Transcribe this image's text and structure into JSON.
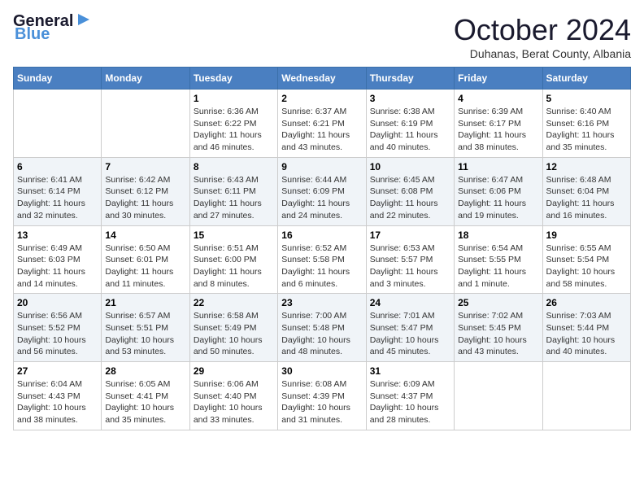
{
  "header": {
    "logo_line1": "General",
    "logo_line2": "Blue",
    "month_title": "October 2024",
    "location": "Duhanas, Berat County, Albania"
  },
  "days_of_week": [
    "Sunday",
    "Monday",
    "Tuesday",
    "Wednesday",
    "Thursday",
    "Friday",
    "Saturday"
  ],
  "weeks": [
    [
      {
        "day": "",
        "detail": ""
      },
      {
        "day": "",
        "detail": ""
      },
      {
        "day": "1",
        "detail": "Sunrise: 6:36 AM\nSunset: 6:22 PM\nDaylight: 11 hours and 46 minutes."
      },
      {
        "day": "2",
        "detail": "Sunrise: 6:37 AM\nSunset: 6:21 PM\nDaylight: 11 hours and 43 minutes."
      },
      {
        "day": "3",
        "detail": "Sunrise: 6:38 AM\nSunset: 6:19 PM\nDaylight: 11 hours and 40 minutes."
      },
      {
        "day": "4",
        "detail": "Sunrise: 6:39 AM\nSunset: 6:17 PM\nDaylight: 11 hours and 38 minutes."
      },
      {
        "day": "5",
        "detail": "Sunrise: 6:40 AM\nSunset: 6:16 PM\nDaylight: 11 hours and 35 minutes."
      }
    ],
    [
      {
        "day": "6",
        "detail": "Sunrise: 6:41 AM\nSunset: 6:14 PM\nDaylight: 11 hours and 32 minutes."
      },
      {
        "day": "7",
        "detail": "Sunrise: 6:42 AM\nSunset: 6:12 PM\nDaylight: 11 hours and 30 minutes."
      },
      {
        "day": "8",
        "detail": "Sunrise: 6:43 AM\nSunset: 6:11 PM\nDaylight: 11 hours and 27 minutes."
      },
      {
        "day": "9",
        "detail": "Sunrise: 6:44 AM\nSunset: 6:09 PM\nDaylight: 11 hours and 24 minutes."
      },
      {
        "day": "10",
        "detail": "Sunrise: 6:45 AM\nSunset: 6:08 PM\nDaylight: 11 hours and 22 minutes."
      },
      {
        "day": "11",
        "detail": "Sunrise: 6:47 AM\nSunset: 6:06 PM\nDaylight: 11 hours and 19 minutes."
      },
      {
        "day": "12",
        "detail": "Sunrise: 6:48 AM\nSunset: 6:04 PM\nDaylight: 11 hours and 16 minutes."
      }
    ],
    [
      {
        "day": "13",
        "detail": "Sunrise: 6:49 AM\nSunset: 6:03 PM\nDaylight: 11 hours and 14 minutes."
      },
      {
        "day": "14",
        "detail": "Sunrise: 6:50 AM\nSunset: 6:01 PM\nDaylight: 11 hours and 11 minutes."
      },
      {
        "day": "15",
        "detail": "Sunrise: 6:51 AM\nSunset: 6:00 PM\nDaylight: 11 hours and 8 minutes."
      },
      {
        "day": "16",
        "detail": "Sunrise: 6:52 AM\nSunset: 5:58 PM\nDaylight: 11 hours and 6 minutes."
      },
      {
        "day": "17",
        "detail": "Sunrise: 6:53 AM\nSunset: 5:57 PM\nDaylight: 11 hours and 3 minutes."
      },
      {
        "day": "18",
        "detail": "Sunrise: 6:54 AM\nSunset: 5:55 PM\nDaylight: 11 hours and 1 minute."
      },
      {
        "day": "19",
        "detail": "Sunrise: 6:55 AM\nSunset: 5:54 PM\nDaylight: 10 hours and 58 minutes."
      }
    ],
    [
      {
        "day": "20",
        "detail": "Sunrise: 6:56 AM\nSunset: 5:52 PM\nDaylight: 10 hours and 56 minutes."
      },
      {
        "day": "21",
        "detail": "Sunrise: 6:57 AM\nSunset: 5:51 PM\nDaylight: 10 hours and 53 minutes."
      },
      {
        "day": "22",
        "detail": "Sunrise: 6:58 AM\nSunset: 5:49 PM\nDaylight: 10 hours and 50 minutes."
      },
      {
        "day": "23",
        "detail": "Sunrise: 7:00 AM\nSunset: 5:48 PM\nDaylight: 10 hours and 48 minutes."
      },
      {
        "day": "24",
        "detail": "Sunrise: 7:01 AM\nSunset: 5:47 PM\nDaylight: 10 hours and 45 minutes."
      },
      {
        "day": "25",
        "detail": "Sunrise: 7:02 AM\nSunset: 5:45 PM\nDaylight: 10 hours and 43 minutes."
      },
      {
        "day": "26",
        "detail": "Sunrise: 7:03 AM\nSunset: 5:44 PM\nDaylight: 10 hours and 40 minutes."
      }
    ],
    [
      {
        "day": "27",
        "detail": "Sunrise: 6:04 AM\nSunset: 4:43 PM\nDaylight: 10 hours and 38 minutes."
      },
      {
        "day": "28",
        "detail": "Sunrise: 6:05 AM\nSunset: 4:41 PM\nDaylight: 10 hours and 35 minutes."
      },
      {
        "day": "29",
        "detail": "Sunrise: 6:06 AM\nSunset: 4:40 PM\nDaylight: 10 hours and 33 minutes."
      },
      {
        "day": "30",
        "detail": "Sunrise: 6:08 AM\nSunset: 4:39 PM\nDaylight: 10 hours and 31 minutes."
      },
      {
        "day": "31",
        "detail": "Sunrise: 6:09 AM\nSunset: 4:37 PM\nDaylight: 10 hours and 28 minutes."
      },
      {
        "day": "",
        "detail": ""
      },
      {
        "day": "",
        "detail": ""
      }
    ]
  ]
}
